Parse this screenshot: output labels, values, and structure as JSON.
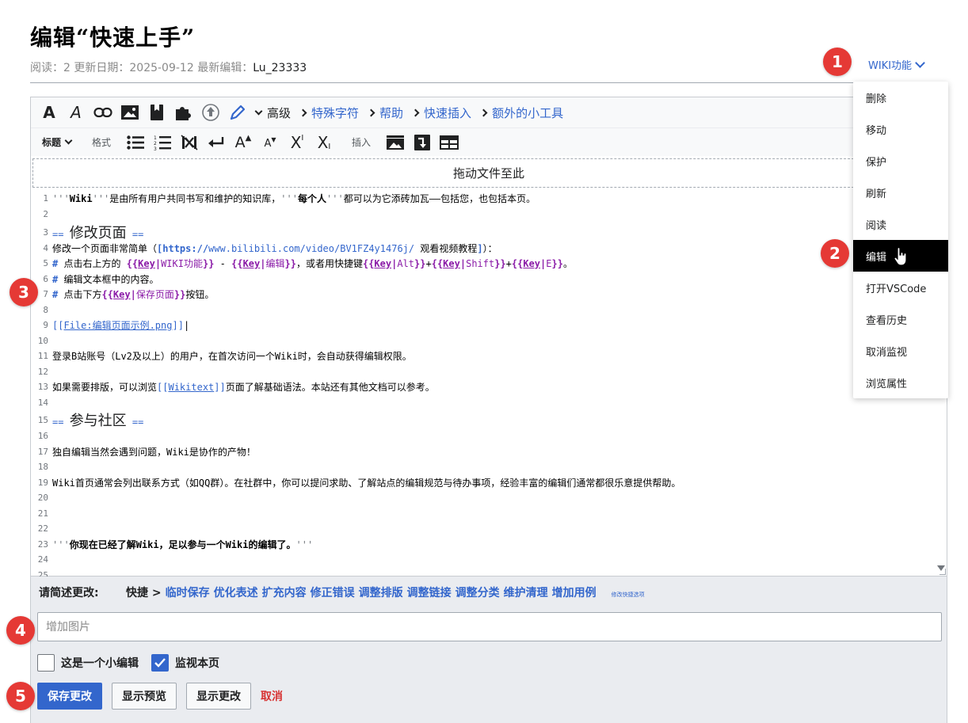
{
  "page": {
    "title": "编辑“快速上手”",
    "meta_reads": "阅读：2",
    "meta_updated": "更新日期：2025-09-12",
    "meta_last_editor_label": "最新编辑：",
    "meta_last_editor": "Lu_23333"
  },
  "wiki_menu": {
    "label": "WIKI功能",
    "items": [
      "删除",
      "移动",
      "保护",
      "刷新",
      "阅读",
      "编辑",
      "打开VSCode",
      "查看历史",
      "取消监视",
      "浏览属性"
    ],
    "active_item": "编辑"
  },
  "badges": [
    "1",
    "2",
    "3",
    "4",
    "5"
  ],
  "toolbar": {
    "row1_icons": [
      "bold-icon",
      "italic-icon",
      "link-icon",
      "image-icon",
      "reference-icon",
      "puzzle-icon",
      "upload-icon",
      "pencil-icon"
    ],
    "advanced": "高级",
    "special_chars": "特殊字符",
    "help": "帮助",
    "quick_insert": "快速插入",
    "extra_tools": "额外的小工具",
    "heading": "标题",
    "format": "格式",
    "insert": "插入"
  },
  "dropzone": "拖动文件至此",
  "code_lines": [
    {
      "n": "1",
      "text": "'''Wiki'''是由所有用户共同书写和维护的知识库，'''每个人'''都可以为它添砖加瓦——包括您，也包括本页。"
    },
    {
      "n": "2",
      "text": ""
    },
    {
      "n": "3",
      "text": "== 修改页面 =="
    },
    {
      "n": "4",
      "text": "修改一个页面非常简单（[https://www.bilibili.com/video/BV1FZ4y1476j/ 观看视频教程]）："
    },
    {
      "n": "5",
      "text": "# 点击右上方的 {{Key|WIKI功能}} - {{Key|编辑}}，或者用快捷键{{Key|Alt}}+{{Key|Shift}}+{{Key|E}}。"
    },
    {
      "n": "6",
      "text": "# 编辑文本框中的内容。"
    },
    {
      "n": "7",
      "text": "# 点击下方{{Key|保存页面}}按钮。"
    },
    {
      "n": "8",
      "text": ""
    },
    {
      "n": "9",
      "text": "[[File:编辑页面示例.png]]"
    },
    {
      "n": "10",
      "text": ""
    },
    {
      "n": "11",
      "text": "登录B站账号（Lv2及以上）的用户，在首次访问一个Wiki时，会自动获得编辑权限。"
    },
    {
      "n": "12",
      "text": ""
    },
    {
      "n": "13",
      "text": "如果需要排版，可以浏览[[Wikitext]]页面了解基础语法。本站还有其他文档可以参考。"
    },
    {
      "n": "14",
      "text": ""
    },
    {
      "n": "15",
      "text": "== 参与社区 =="
    },
    {
      "n": "16",
      "text": ""
    },
    {
      "n": "17",
      "text": "独自编辑当然会遇到问题，Wiki是协作的产物！"
    },
    {
      "n": "18",
      "text": ""
    },
    {
      "n": "19",
      "text": "Wiki首页通常会列出联系方式（如QQ群）。在社群中，你可以提问求助、了解站点的编辑规范与待办事项，经验丰富的编辑们通常都很乐意提供帮助。"
    },
    {
      "n": "20",
      "text": ""
    },
    {
      "n": "21",
      "text": ""
    },
    {
      "n": "22",
      "text": ""
    },
    {
      "n": "23",
      "text": "'''你现在已经了解Wiki，足以参与一个Wiki的编辑了。'''"
    },
    {
      "n": "24",
      "text": ""
    },
    {
      "n": "25",
      "text": ""
    }
  ],
  "summary": {
    "label": "请简述更改:",
    "quick_label": "快捷 >",
    "quick_items": [
      "临时保存",
      "优化表述",
      "扩充内容",
      "修正错误",
      "调整排版",
      "调整链接",
      "调整分类",
      "维护清理",
      "增加用例"
    ],
    "quick_edit_link": "修改快捷选项",
    "input_value": "",
    "input_placeholder": "增加图片",
    "minor_label": "这是一个小编辑",
    "minor_checked": false,
    "watch_label": "监视本页",
    "watch_checked": true
  },
  "buttons": {
    "save": "保存更改",
    "preview": "显示预览",
    "diff": "显示更改",
    "cancel": "取消"
  },
  "colors": {
    "accent": "#3366cc",
    "badge": "#e53935",
    "cancel": "#d73333"
  }
}
